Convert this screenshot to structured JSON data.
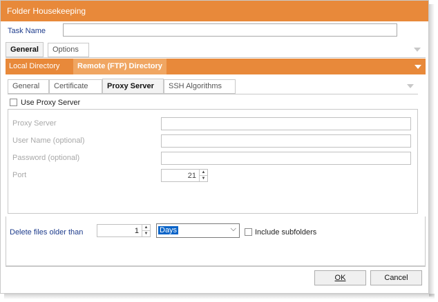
{
  "window": {
    "title": "Folder Housekeeping"
  },
  "task_name": {
    "label": "Task Name",
    "value": ""
  },
  "main_tabs": [
    {
      "label": "General",
      "active": true
    },
    {
      "label": "Options",
      "active": false
    }
  ],
  "dir_tabs": [
    {
      "label": "Local Directory",
      "active": false
    },
    {
      "label": "Remote (FTP) Directory",
      "active": true
    }
  ],
  "sub_tabs": [
    {
      "label": "General",
      "active": false
    },
    {
      "label": "Certificate",
      "active": false
    },
    {
      "label": "Proxy Server",
      "active": true
    },
    {
      "label": "SSH Algorithms",
      "active": false
    }
  ],
  "proxy": {
    "use_label": "Use Proxy Server",
    "use_checked": false,
    "server_label": "Proxy Server",
    "server_value": "",
    "user_label": "User Name (optional)",
    "user_value": "",
    "password_label": "Password (optional)",
    "password_value": "",
    "port_label": "Port",
    "port_value": "21"
  },
  "delete": {
    "label": "Delete files older than",
    "value": "1",
    "unit": "Days",
    "include_label": "Include subfolders",
    "include_checked": false
  },
  "buttons": {
    "ok": "OK",
    "cancel": "Cancel"
  },
  "colors": {
    "title_bar": "#e8893a",
    "active_dir_tab": "#f0a662",
    "label_blue": "#1e3c8c"
  },
  "icons": [
    "tabs-overflow-icon",
    "chevron-down-icon",
    "spin-up-icon",
    "spin-down-icon"
  ]
}
